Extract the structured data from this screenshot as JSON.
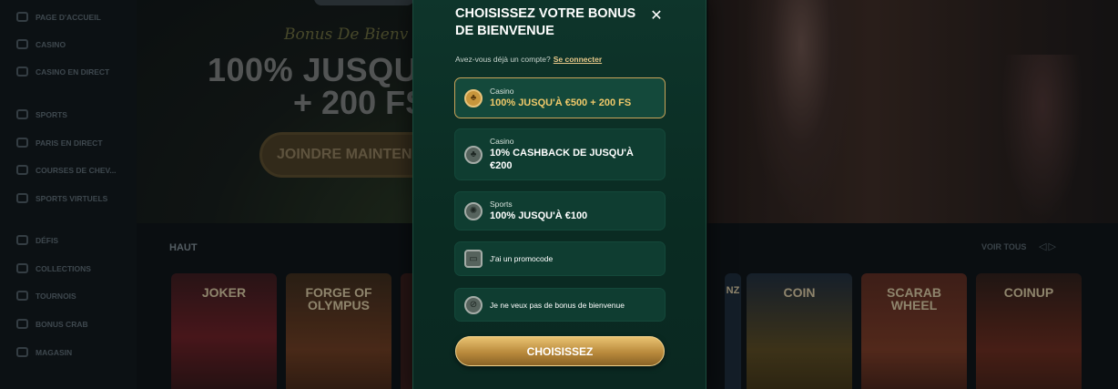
{
  "sidebar": {
    "items": [
      {
        "label": "PAGE D'ACCUEIL",
        "icon": "home-icon"
      },
      {
        "label": "CASINO",
        "icon": "casino-icon"
      },
      {
        "label": "CASINO EN DIRECT",
        "icon": "live-casino-icon"
      },
      {
        "label": "SPORTS",
        "icon": "sports-icon"
      },
      {
        "label": "PARIS EN DIRECT",
        "icon": "live-bets-icon"
      },
      {
        "label": "COURSES DE CHEV...",
        "icon": "horse-racing-icon"
      },
      {
        "label": "SPORTS VIRTUELS",
        "icon": "virtual-sports-icon"
      },
      {
        "label": "DÉFIS",
        "icon": "challenges-icon"
      },
      {
        "label": "COLLECTIONS",
        "icon": "collections-icon"
      },
      {
        "label": "TOURNOIS",
        "icon": "trophy-icon"
      },
      {
        "label": "BONUS CRAB",
        "icon": "crab-icon"
      },
      {
        "label": "MAGASIN",
        "icon": "shop-icon"
      }
    ]
  },
  "hero": {
    "script": "Bonus De Bienv",
    "line1": "100% JUSQU'À",
    "line2": "+ 200 FS",
    "button": "JOINDRE MAINTENANT"
  },
  "section": {
    "title": "HAUT",
    "see_all": "VOIR TOUS"
  },
  "games": [
    {
      "title": "JOKER"
    },
    {
      "title": "FORGE OF OLYMPUS"
    },
    {
      "title": ""
    },
    {
      "title": "NZ"
    },
    {
      "title": "COIN"
    },
    {
      "title": "SCARAB WHEEL"
    },
    {
      "title": "COINUP"
    }
  ],
  "modal": {
    "title": "CHOISISSEZ VOTRE BONUS DE BIENVENUE",
    "close_icon": "close-icon",
    "login_prompt": "Avez-vous déjà un compte?",
    "login_link": "Se connecter",
    "options": [
      {
        "category": "Casino",
        "value": "100% JUSQU'À €500 + 200 FS",
        "icon": "cherry-icon",
        "selected": true
      },
      {
        "category": "Casino",
        "value": "10% CASHBACK DE JUSQU'À €200",
        "icon": "cherry-icon",
        "selected": false
      },
      {
        "category": "Sports",
        "value": "100% JUSQU'À €100",
        "icon": "soccer-ball-icon",
        "selected": false
      },
      {
        "label": "J'ai un promocode",
        "icon": "ticket-icon",
        "selected": false
      },
      {
        "label": "Je ne veux pas de bonus de bienvenue",
        "icon": "no-bonus-icon",
        "selected": false
      }
    ],
    "submit": "CHOISISSEZ"
  },
  "colors": {
    "modal_bg": "#0e352b",
    "accent_gold": "#e8c37a",
    "option_bg": "#0f3d31"
  }
}
